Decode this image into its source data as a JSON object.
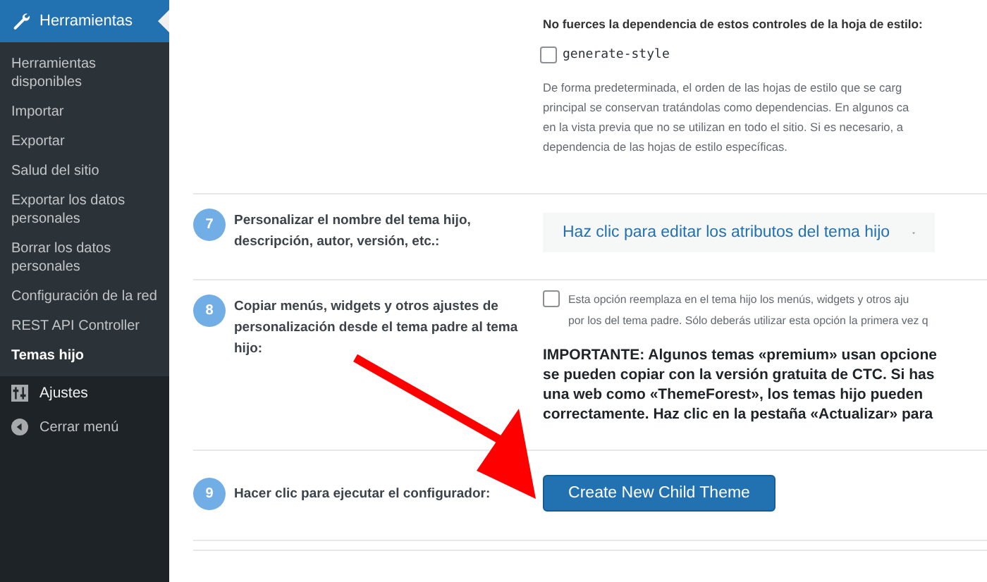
{
  "sidebar": {
    "header": {
      "label": "Herramientas"
    },
    "items": [
      {
        "label": "Herramientas disponibles",
        "selected": false
      },
      {
        "label": "Importar",
        "selected": false
      },
      {
        "label": "Exportar",
        "selected": false
      },
      {
        "label": "Salud del sitio",
        "selected": false
      },
      {
        "label": "Exportar los datos personales",
        "selected": false
      },
      {
        "label": "Borrar los datos personales",
        "selected": false
      },
      {
        "label": "Configuración de la red",
        "selected": false
      },
      {
        "label": "REST API Controller",
        "selected": false
      },
      {
        "label": "Temas hijo",
        "selected": true
      }
    ],
    "settings": {
      "label": "Ajustes"
    },
    "collapse": {
      "label": "Cerrar menú"
    }
  },
  "stylesheet_section": {
    "heading": "No fuerces la dependencia de estos controles de la hoja de estilo:",
    "option": {
      "label": "generate-style",
      "checked": false
    },
    "description": [
      "De forma predeterminada, el orden de las hojas de estilo que se carg",
      "principal se conservan tratándolas como dependencias. En algunos ca",
      "en la vista previa que no se utilizan en todo el sitio. Si es necesario, a",
      "dependencia de las hojas de estilo específicas."
    ]
  },
  "steps": [
    {
      "number": "7",
      "label": "Personalizar el nombre del tema hijo, descripción, autor, versión, etc.:",
      "kind": "dropdown",
      "control": "Haz clic para editar los atributos del tema hijo"
    },
    {
      "number": "8",
      "label": "Copiar menús, widgets y otros ajustes de personalización desde el tema padre al tema hijo:",
      "kind": "checkbox",
      "checked": false,
      "option": [
        "Esta opción reemplaza en el tema hijo los menús, widgets y otros aju",
        "por los del tema padre. Sólo deberás utilizar esta opción la primera vez q"
      ],
      "note": [
        "IMPORTANTE: Algunos temas «premium» usan opcione",
        "se pueden copiar con la versión gratuita de CTC. Si has",
        "una web como «ThemeForest», los temas hijo pueden",
        "correctamente. Haz clic en la pestaña «Actualizar» para"
      ]
    },
    {
      "number": "9",
      "label": "Hacer clic para ejecutar el configurador:",
      "kind": "button",
      "control": "Create New Child Theme"
    }
  ]
}
